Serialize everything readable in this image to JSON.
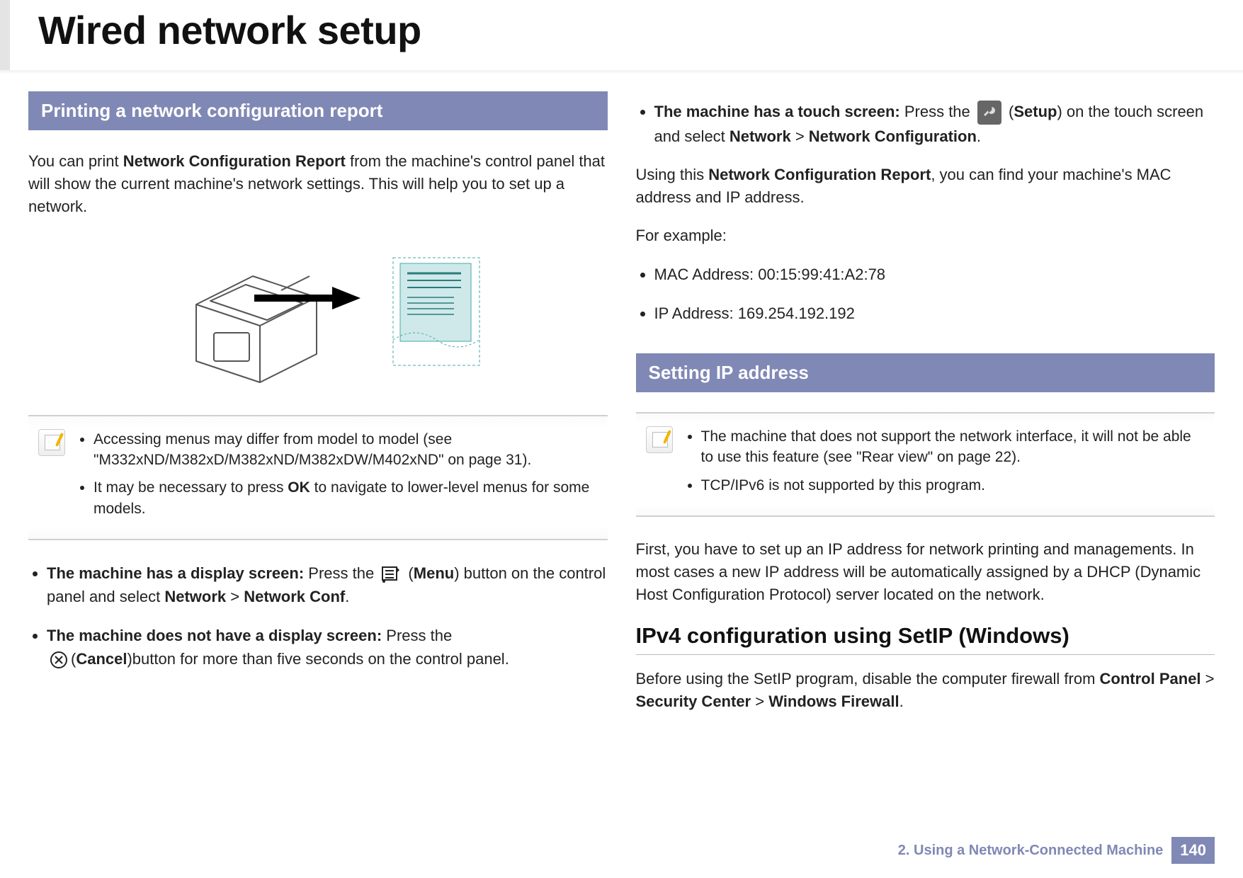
{
  "header": {
    "title": "Wired network setup"
  },
  "left": {
    "section_a_title": "Printing a network configuration report",
    "intro_prefix": "You can print ",
    "intro_bold": "Network Configuration Report",
    "intro_suffix": " from the machine's control panel that will show the current machine's network settings. This will help you to set up a network.",
    "note1": "Accessing menus may differ from model to model (see \"M332xND/M382xD/M382xND/M382xDW/M402xND\" on page 31).",
    "note2_prefix": "It may be necessary to press ",
    "note2_bold": "OK",
    "note2_suffix": " to navigate to lower-level menus for some models.",
    "bullet1_lead": "The machine has a display screen:",
    "bullet1_text_a": " Press the ",
    "bullet1_menu_label": "Menu",
    "bullet1_text_b": ") button on the control panel and select ",
    "bullet1_path1": "Network",
    "bullet1_gt1": " > ",
    "bullet1_path2": "Network Conf",
    "bullet1_period": ".",
    "bullet2_lead": "The machine does not have a display screen:",
    "bullet2_text_a": " Press the ",
    "bullet2_cancel_label": "Cancel",
    "bullet2_text_b": ")button for more than five seconds on the control panel."
  },
  "right": {
    "bullet3_lead": "The machine has a touch screen:",
    "bullet3_text_a": " Press the ",
    "bullet3_setup_label": "Setup",
    "bullet3_text_b": ") on the touch screen and select ",
    "bullet3_path1": "Network",
    "bullet3_gt1": " > ",
    "bullet3_path2": "Network Configuration",
    "bullet3_period": ".",
    "using_prefix": "Using this ",
    "using_bold": "Network Configuration Report",
    "using_suffix": ", you can find your machine's MAC address and IP address.",
    "for_example": "For example:",
    "mac_line": "MAC Address: 00:15:99:41:A2:78",
    "ip_line": "IP Address: 169.254.192.192",
    "section_b_title": "Setting IP address",
    "noteB1": "The machine that does not support the network interface, it will not be able to use this feature (see \"Rear view\" on page 22).",
    "noteB2": "TCP/IPv6 is not supported by this program.",
    "first_para": "First, you have to set up an IP address for network printing and managements. In most cases a new IP address will be automatically assigned by a DHCP (Dynamic Host Configuration Protocol) server located on the network.",
    "subhead": "IPv4 configuration using SetIP (Windows)",
    "before_prefix": "Before using the SetIP program, disable the computer firewall from ",
    "before_p1": "Control Panel",
    "before_gt1": " > ",
    "before_p2": "Security Center",
    "before_gt2": " > ",
    "before_p3": "Windows Firewall",
    "before_period": "."
  },
  "footer": {
    "chapter": "2.  Using a Network-Connected Machine",
    "page": "140"
  }
}
